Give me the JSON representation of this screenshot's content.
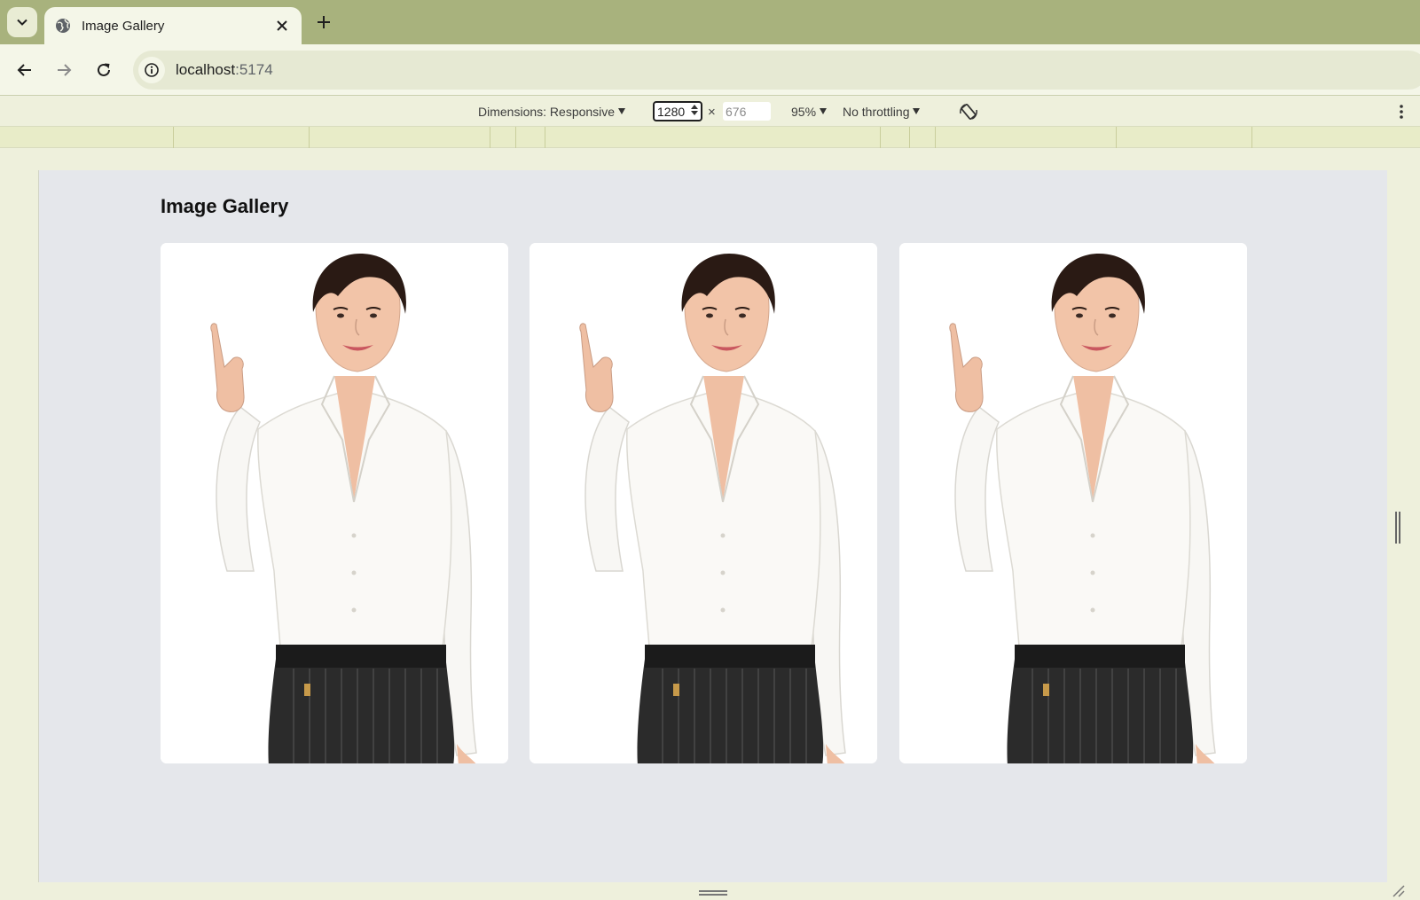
{
  "browser": {
    "tab": {
      "title": "Image Gallery"
    },
    "address": {
      "host": "localhost",
      "port": ":5174"
    }
  },
  "devtools": {
    "dimensions_label": "Dimensions: Responsive",
    "width": "1280",
    "height": "676",
    "times": "×",
    "zoom": "95%",
    "throttling": "No throttling"
  },
  "page": {
    "title": "Image Gallery",
    "images": [
      {
        "subject": "woman pointing up"
      },
      {
        "subject": "woman pointing up"
      },
      {
        "subject": "woman pointing up"
      }
    ]
  },
  "colors": {
    "tabstrip": "#a8b27d",
    "toolbar": "#f4f6e8",
    "viewport_bg": "#e5e7eb",
    "card_bg": "#ffffff"
  }
}
